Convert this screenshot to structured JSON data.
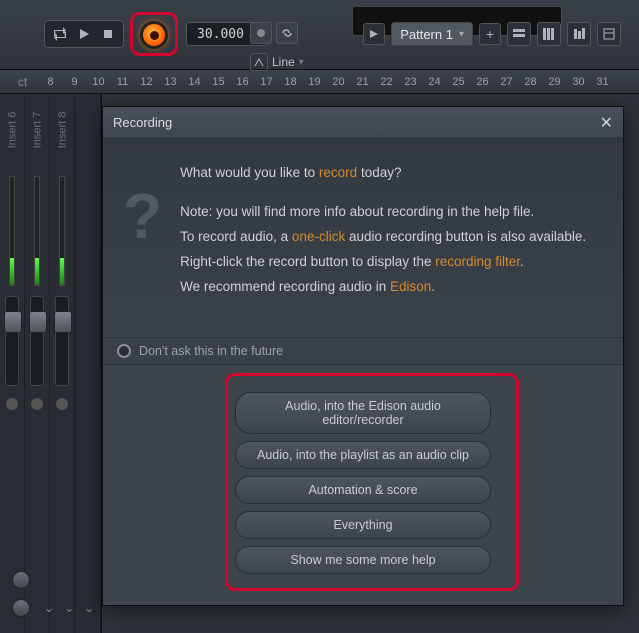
{
  "toolbar": {
    "tempo": "30.000",
    "line_mode": "Line",
    "pattern_label": "Pattern 1"
  },
  "ruler": {
    "numbers": [
      "8",
      "9",
      "10",
      "11",
      "12",
      "13",
      "14",
      "15",
      "16",
      "17",
      "18",
      "19",
      "20",
      "21",
      "22",
      "23",
      "24",
      "25",
      "26",
      "27",
      "28",
      "29",
      "30",
      "31"
    ]
  },
  "mixer": {
    "strips": [
      "Insert 6",
      "Insert 7",
      "Insert 8"
    ]
  },
  "dialog": {
    "title": "Recording",
    "line1_pre": "What would you like to ",
    "line1_link": "record",
    "line1_post": " today?",
    "line2": "Note: you will find more info about recording in the help file.",
    "line3_pre": "To record audio, a ",
    "line3_link": "one-click",
    "line3_post": " audio recording button is also available.",
    "line4_pre": "Right-click the record button to display the ",
    "line4_link": "recording filter",
    "line4_post": ".",
    "line5_pre": "We recommend recording audio in ",
    "line5_link": "Edison",
    "line5_post": ".",
    "dont_ask": "Don't ask this in the future",
    "options": [
      "Audio, into the Edison audio editor/recorder",
      "Audio, into the playlist as an audio clip",
      "Automation & score",
      "Everything",
      "Show me some more help"
    ]
  }
}
